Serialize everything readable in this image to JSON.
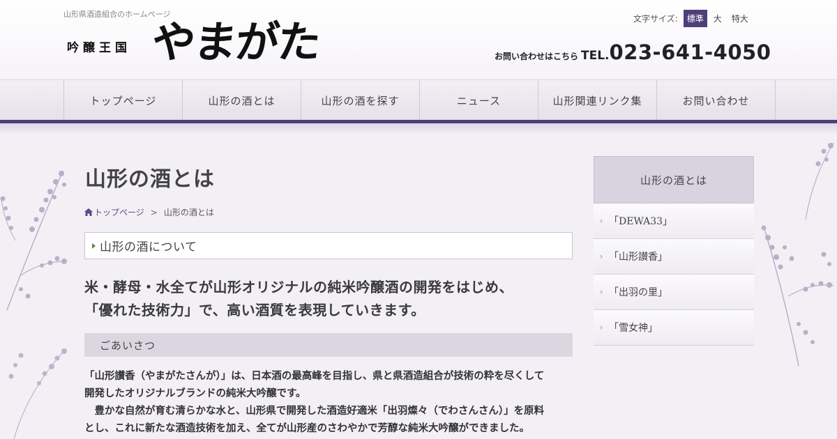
{
  "header": {
    "tagline": "山形県酒造組合のホームページ",
    "logo_small": "吟醸王国",
    "logo_big": "やまがた",
    "font_size_label": "文字サイズ:",
    "font_sizes": [
      "標準",
      "大",
      "特大"
    ],
    "contact_label": "お問い合わせはこちら",
    "tel_prefix": "TEL.",
    "tel_number": "023-641-4050"
  },
  "nav": {
    "items": [
      "トップページ",
      "山形の酒とは",
      "山形の酒を探す",
      "ニュース",
      "山形関連リンク集",
      "お問い合わせ"
    ]
  },
  "main": {
    "page_title": "山形の酒とは",
    "breadcrumb": {
      "home": "トップページ",
      "separator": ">",
      "current": "山形の酒とは"
    },
    "section_title": "山形の酒について",
    "lead": [
      "米・酵母・水全てが山形オリジナルの純米吟醸酒の開発をはじめ、",
      "「優れた技術力」で、高い酒質を表現していきます。"
    ],
    "subhead": "ごあいさつ",
    "body": [
      "「山形讃香（やまがたさんが）」は、日本酒の最高峰を目指し、県と県酒造組合が技術の粋を尽くして",
      "開発したオリジナルブランドの純米大吟醸です。",
      "　豊かな自然が育む清らかな水と、山形県で開発した酒造好適米「出羽燦々（でわさんさん）」を原料",
      "とし、これに新たな酒造技術を加え、全てが山形産のさわやかで芳醇な純米大吟醸ができました。"
    ]
  },
  "sidebar": {
    "title": "山形の酒とは",
    "items": [
      "「DEWA33」",
      "「山形讃香」",
      "「出羽の里」",
      "「雪女神」"
    ]
  },
  "colors": {
    "accent": "#4e3e7a",
    "nav_bg": "#e6e1ea",
    "page_bg": "#f3f0f5",
    "subhead_bg": "#dcd6e1",
    "sidebar_head_bg": "#d9d2df",
    "flower": "#8a7aa6"
  },
  "icons": {
    "home": "home-icon",
    "chevron": "chevron-right-icon",
    "bullet": "triangle-bullet-icon"
  }
}
